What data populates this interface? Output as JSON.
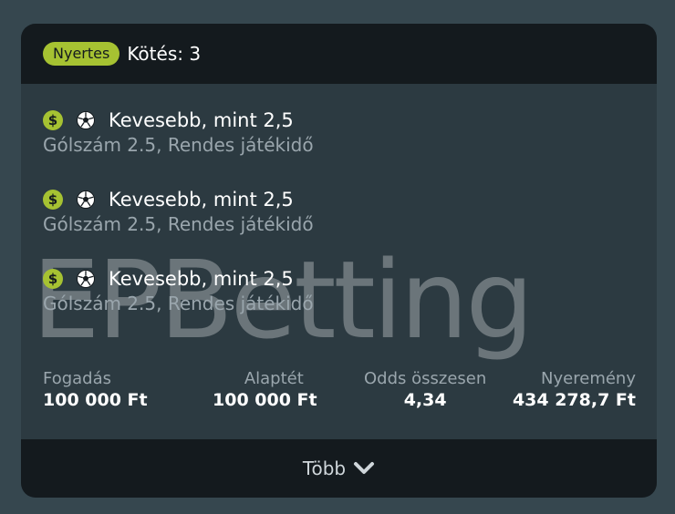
{
  "header": {
    "status_badge": "Nyertes",
    "title": "Kötés: 3"
  },
  "watermark": "EPBetting",
  "selections": [
    {
      "icon": "dollar-icon",
      "sport_icon": "soccer-ball-icon",
      "name": "Kevesebb, mint 2,5",
      "market": "Gólszám 2.5, Rendes játékidő"
    },
    {
      "icon": "dollar-icon",
      "sport_icon": "soccer-ball-icon",
      "name": "Kevesebb, mint 2,5",
      "market": "Gólszám 2.5, Rendes játékidő"
    },
    {
      "icon": "dollar-icon",
      "sport_icon": "soccer-ball-icon",
      "name": "Kevesebb, mint 2,5",
      "market": "Gólszám 2.5, Rendes játékidő"
    }
  ],
  "dollar_symbol": "$",
  "stats": {
    "stake_label": "Fogadás",
    "stake_value": "100 000 Ft",
    "base_label": "Alaptét",
    "base_value": "100 000 Ft",
    "odds_label": "Odds összesen",
    "odds_value": "4,34",
    "winnings_label": "Nyeremény",
    "winnings_value": "434 278,7 Ft"
  },
  "footer": {
    "more_label": "Több"
  },
  "colors": {
    "background": "#36474f",
    "card": "#2c3a41",
    "header": "#141a1e",
    "accent": "#a6c232"
  }
}
